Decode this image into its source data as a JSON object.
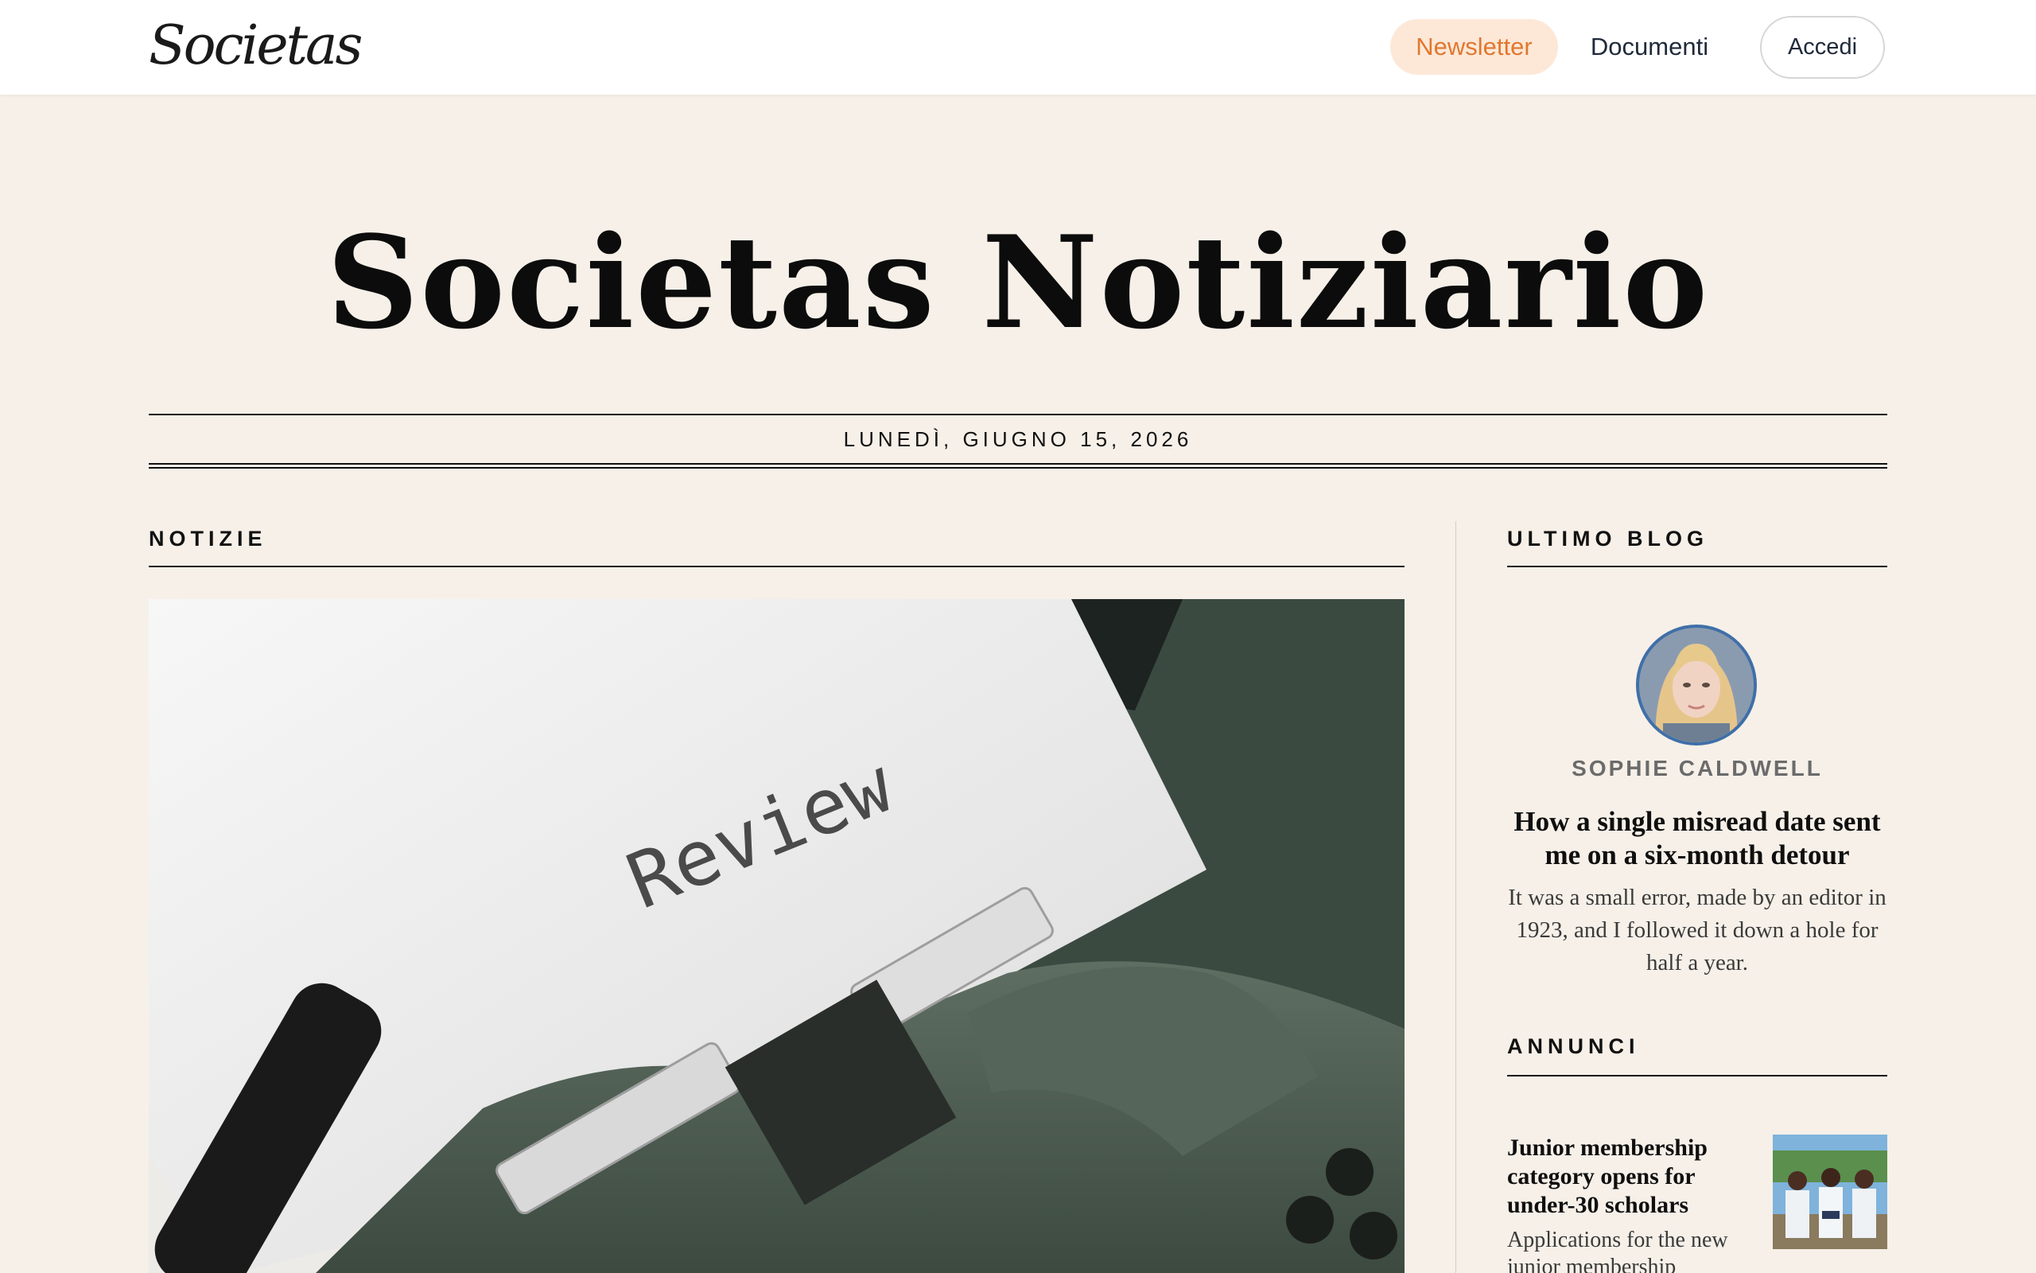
{
  "header": {
    "logo_text": "Societas",
    "nav": {
      "newsletter": "Newsletter",
      "documents": "Documenti",
      "login": "Accedi"
    }
  },
  "masthead": {
    "title": "Societas Notiziario",
    "date": "LUNEDÌ, GIUGNO 15, 2026"
  },
  "news": {
    "section_title": "NOTIZIE",
    "hero_image_word": "Review"
  },
  "blog": {
    "section_title": "ULTIMO BLOG",
    "author": "SOPHIE CALDWELL",
    "title": "How a single misread date sent me on a six-month detour",
    "excerpt": "It was a small error, made by an editor in 1923, and I followed it down a hole for half a year."
  },
  "announcements": {
    "section_title": "ANNUNCI",
    "items": [
      {
        "title": "Junior membership category opens for under-30 scholars",
        "excerpt": "Applications for the new junior membership"
      }
    ]
  },
  "colors": {
    "page_background": "#f6f0e8",
    "accent": "#e0782f",
    "accent_bg": "#fde8d8",
    "avatar_ring": "#3f6fa8"
  }
}
